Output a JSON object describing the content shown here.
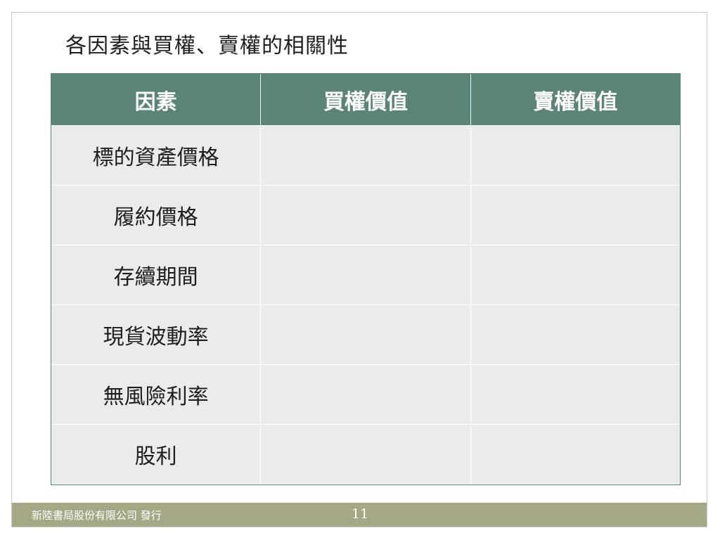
{
  "slide": {
    "title": "各因素與買權、賣權的相關性",
    "table": {
      "headers": [
        "因素",
        "買權價值",
        "賣權價值"
      ],
      "rows": [
        [
          "標的資產價格",
          "",
          ""
        ],
        [
          "履約價格",
          "",
          ""
        ],
        [
          "存續期間",
          "",
          ""
        ],
        [
          "現貨波動率",
          "",
          ""
        ],
        [
          "無風險利率",
          "",
          ""
        ],
        [
          "股利",
          "",
          ""
        ]
      ]
    },
    "footer": {
      "publisher": "新陸書局股份有限公司 發行",
      "page_number": "11"
    }
  },
  "colors": {
    "header_bg": "#5a8478",
    "cell_bg": "#eaecea",
    "footer_bg": "#a5a785"
  }
}
